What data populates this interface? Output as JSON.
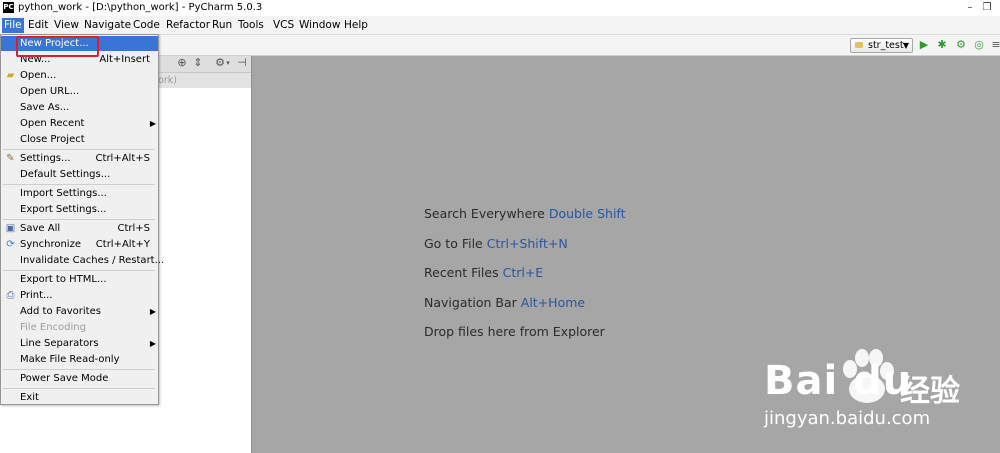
{
  "window": {
    "title": "python_work - [D:\\python_work] - PyCharm 5.0.3",
    "logo": "PC"
  },
  "menubar": [
    "File",
    "Edit",
    "View",
    "Navigate",
    "Code",
    "Refactor",
    "Run",
    "Tools",
    "VCS",
    "Window",
    "Help"
  ],
  "toolbar": {
    "run_config": "str_test"
  },
  "project_panel": {
    "subtitle": "ork)"
  },
  "file_menu": {
    "items": [
      {
        "label": "New Project...",
        "shortcut": "",
        "icon": "",
        "highlight": true
      },
      {
        "label": "New...",
        "shortcut": "Alt+Insert",
        "icon": ""
      },
      {
        "label": "Open...",
        "shortcut": "",
        "icon": "folder-icon"
      },
      {
        "label": "Open URL...",
        "shortcut": "",
        "icon": ""
      },
      {
        "label": "Save As...",
        "shortcut": "",
        "icon": ""
      },
      {
        "label": "Open Recent",
        "shortcut": "",
        "icon": "",
        "submenu": true
      },
      {
        "label": "Close Project",
        "shortcut": "",
        "icon": ""
      },
      {
        "label": "Settings...",
        "shortcut": "Ctrl+Alt+S",
        "icon": "wrench-icon"
      },
      {
        "label": "Default Settings...",
        "shortcut": "",
        "icon": ""
      },
      {
        "label": "Import Settings...",
        "shortcut": "",
        "icon": ""
      },
      {
        "label": "Export Settings...",
        "shortcut": "",
        "icon": ""
      },
      {
        "label": "Save All",
        "shortcut": "Ctrl+S",
        "icon": "save-icon"
      },
      {
        "label": "Synchronize",
        "shortcut": "Ctrl+Alt+Y",
        "icon": "sync-icon"
      },
      {
        "label": "Invalidate Caches / Restart...",
        "shortcut": "",
        "icon": ""
      },
      {
        "label": "Export to HTML...",
        "shortcut": "",
        "icon": ""
      },
      {
        "label": "Print...",
        "shortcut": "",
        "icon": "printer-icon"
      },
      {
        "label": "Add to Favorites",
        "shortcut": "",
        "icon": "",
        "submenu": true
      },
      {
        "label": "File Encoding",
        "shortcut": "",
        "icon": "",
        "disabled": true
      },
      {
        "label": "Line Separators",
        "shortcut": "",
        "icon": "",
        "submenu": true
      },
      {
        "label": "Make File Read-only",
        "shortcut": "",
        "icon": ""
      },
      {
        "label": "Power Save Mode",
        "shortcut": "",
        "icon": ""
      },
      {
        "label": "Exit",
        "shortcut": "",
        "icon": ""
      }
    ]
  },
  "editor_hints": [
    {
      "text": "Search Everywhere",
      "key": "Double Shift"
    },
    {
      "text": "Go to File",
      "key": "Ctrl+Shift+N"
    },
    {
      "text": "Recent Files",
      "key": "Ctrl+E"
    },
    {
      "text": "Navigation Bar",
      "key": "Alt+Home"
    },
    {
      "text": "Drop files here from Explorer",
      "key": ""
    }
  ],
  "watermark": {
    "brand": "Bai  du",
    "cn": "经验",
    "url": "jingyan.baidu.com"
  },
  "colors": {
    "highlight": "#3875d7",
    "editor_bg": "#a6a6a6",
    "hint_key": "#28569e",
    "annotation": "#e02020"
  }
}
